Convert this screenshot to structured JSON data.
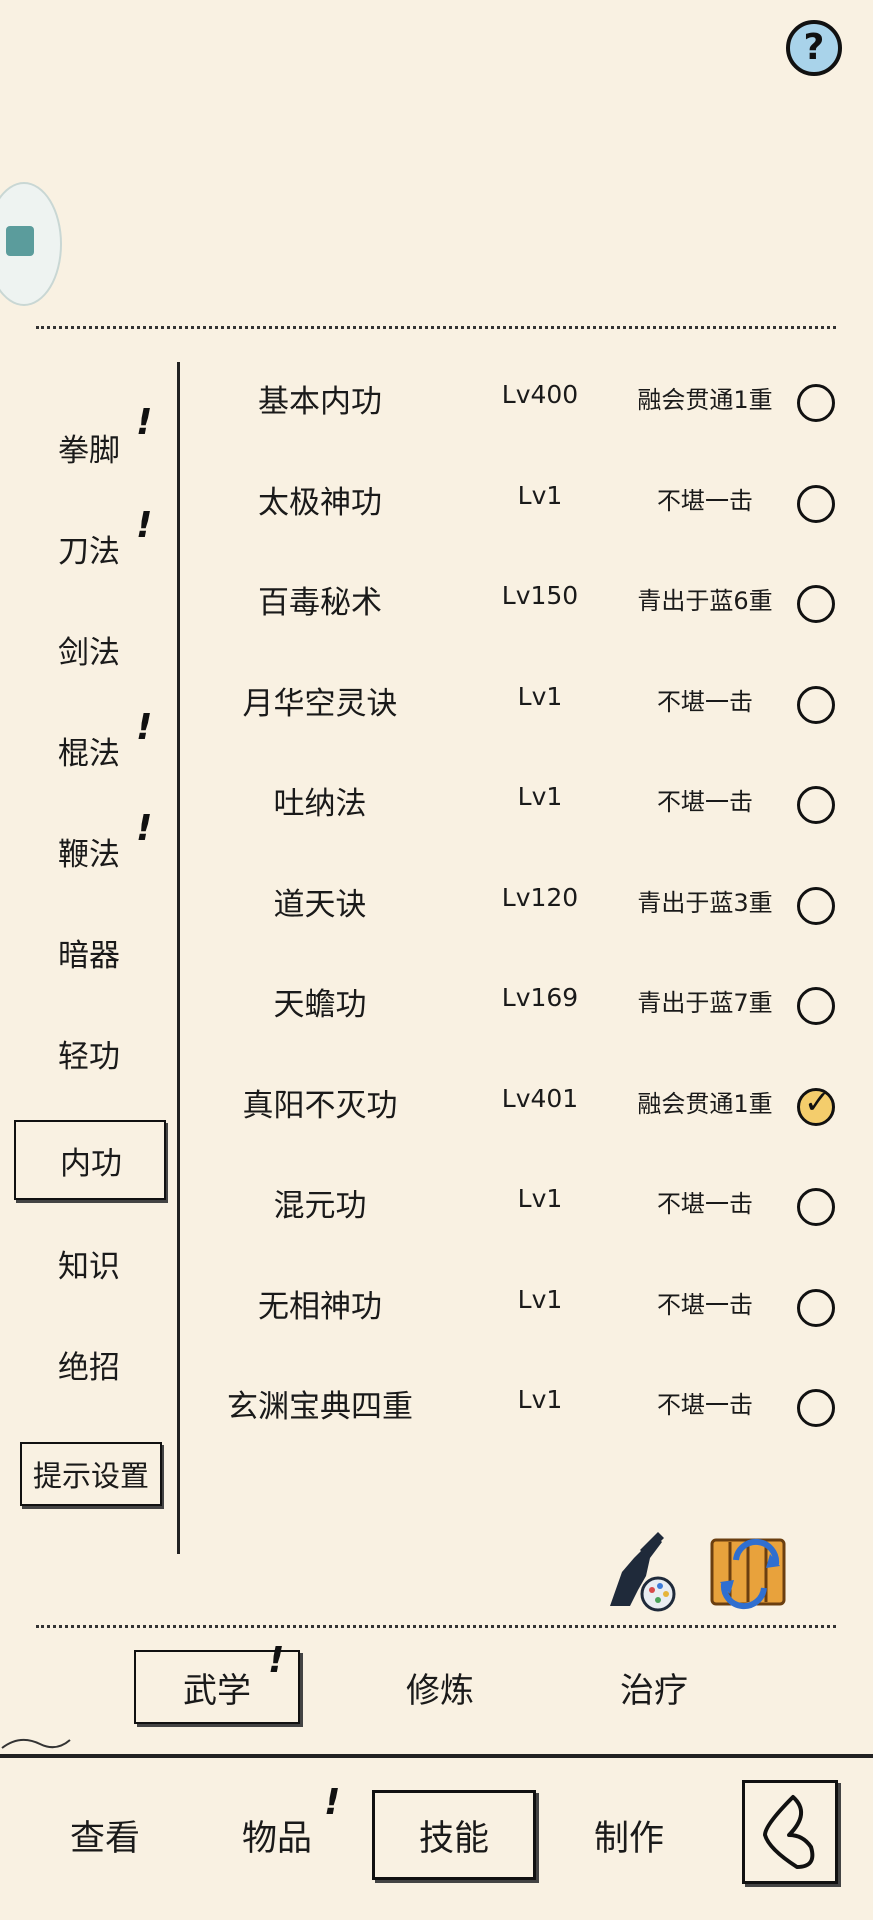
{
  "header": {
    "help_label": "?"
  },
  "categories": [
    {
      "label": "拳脚",
      "alert": "!"
    },
    {
      "label": "刀法",
      "alert": "!"
    },
    {
      "label": "剑法",
      "alert": ""
    },
    {
      "label": "棍法",
      "alert": "!"
    },
    {
      "label": "鞭法",
      "alert": "!"
    },
    {
      "label": "暗器",
      "alert": ""
    },
    {
      "label": "轻功",
      "alert": ""
    },
    {
      "label": "内功",
      "alert": "",
      "active": true
    },
    {
      "label": "知识",
      "alert": ""
    },
    {
      "label": "绝招",
      "alert": ""
    }
  ],
  "hint_settings": "提示设置",
  "skills": [
    {
      "name": "基本内功",
      "level": "Lv400",
      "rank": "融会贯通1重",
      "checked": false
    },
    {
      "name": "太极神功",
      "level": "Lv1",
      "rank": "不堪一击",
      "checked": false
    },
    {
      "name": "百毒秘术",
      "level": "Lv150",
      "rank": "青出于蓝6重",
      "checked": false
    },
    {
      "name": "月华空灵诀",
      "level": "Lv1",
      "rank": "不堪一击",
      "checked": false
    },
    {
      "name": "吐纳法",
      "level": "Lv1",
      "rank": "不堪一击",
      "checked": false
    },
    {
      "name": "道天诀",
      "level": "Lv120",
      "rank": "青出于蓝3重",
      "checked": false
    },
    {
      "name": "天蟾功",
      "level": "Lv169",
      "rank": "青出于蓝7重",
      "checked": false
    },
    {
      "name": "真阳不灭功",
      "level": "Lv401",
      "rank": "融会贯通1重",
      "checked": true
    },
    {
      "name": "混元功",
      "level": "Lv1",
      "rank": "不堪一击",
      "checked": false
    },
    {
      "name": "无相神功",
      "level": "Lv1",
      "rank": "不堪一击",
      "checked": false
    },
    {
      "name": "玄渊宝典四重",
      "level": "Lv1",
      "rank": "不堪一击",
      "checked": false
    }
  ],
  "subtabs": [
    {
      "label": "武学",
      "alert": "!"
    },
    {
      "label": "修炼",
      "alert": ""
    },
    {
      "label": "治疗",
      "alert": ""
    }
  ],
  "bottom_tabs": [
    {
      "label": "查看",
      "alert": ""
    },
    {
      "label": "物品",
      "alert": "!"
    },
    {
      "label": "技能",
      "alert": ""
    },
    {
      "label": "制作",
      "alert": ""
    }
  ],
  "colors": {
    "background": "#f9f1e2",
    "checked_fill": "#f4cd6c",
    "help_fill": "#a9d3ea"
  },
  "icons": [
    "help-icon",
    "paint-figure-icon",
    "swap-scroll-icon",
    "back-icon"
  ]
}
